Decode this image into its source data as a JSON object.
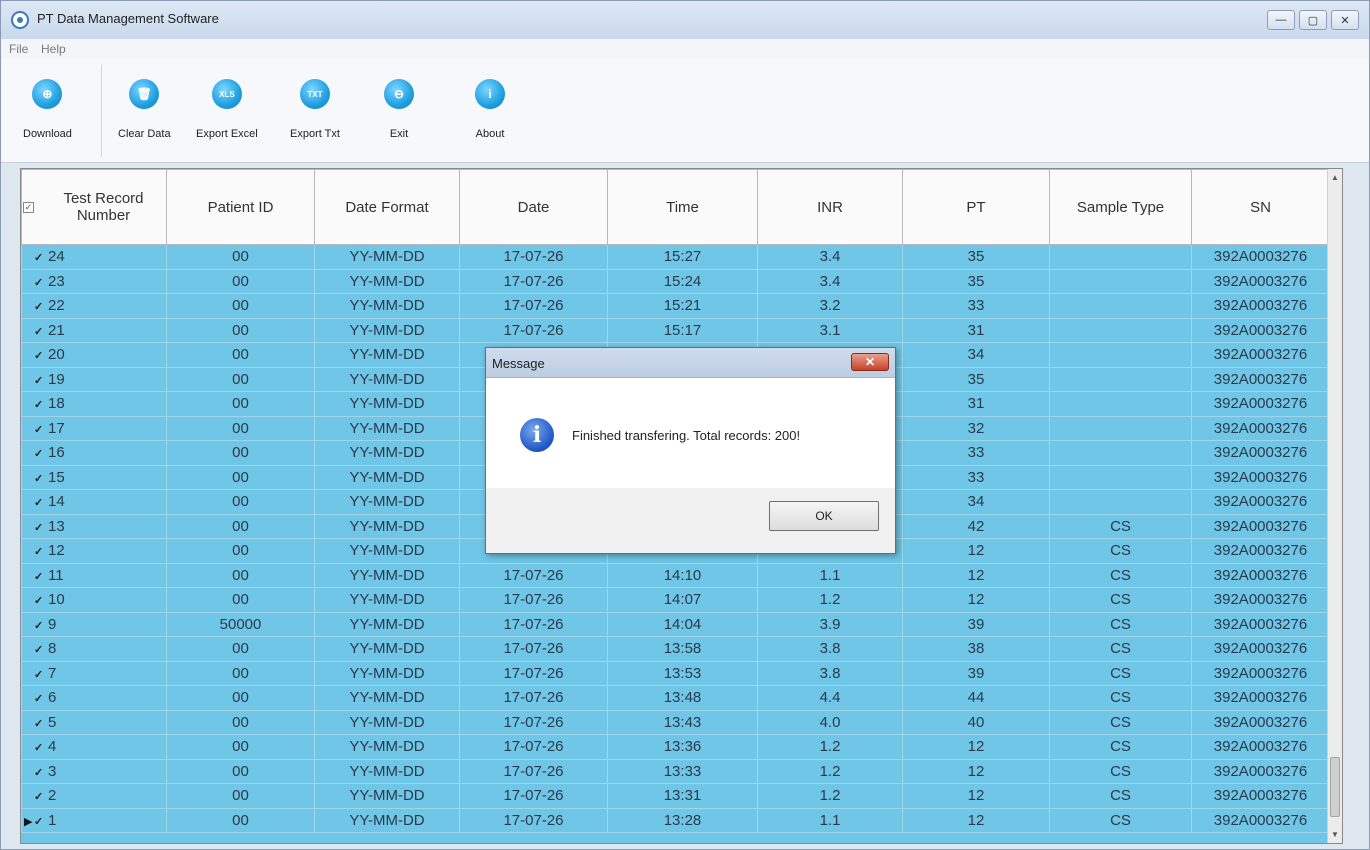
{
  "window": {
    "title": "PT Data Management Software",
    "controls": [
      "—",
      "▢",
      "✕"
    ]
  },
  "menu": {
    "file": "File",
    "help": "Help"
  },
  "toolbar": {
    "download": {
      "label": "Download",
      "glyph": "⊕"
    },
    "clear": {
      "label": "Clear Data",
      "glyph": "🗑"
    },
    "excel": {
      "label": "Export Excel",
      "glyph": "XLS"
    },
    "txt": {
      "label": "Export Txt",
      "glyph": "TXT"
    },
    "exit": {
      "label": "Exit",
      "glyph": "⊖"
    },
    "about": {
      "label": "About",
      "glyph": "i"
    }
  },
  "table": {
    "columns": [
      "Test Record Number",
      "Patient ID",
      "Date Format",
      "Date",
      "Time",
      "INR",
      "PT",
      "Sample Type",
      "SN"
    ],
    "rows": [
      {
        "num": "24",
        "pid": "00",
        "fmt": "YY-MM-DD",
        "date": "17-07-26",
        "time": "15:27",
        "inr": "3.4",
        "pt": "35",
        "sample": "",
        "sn": "392A0003276"
      },
      {
        "num": "23",
        "pid": "00",
        "fmt": "YY-MM-DD",
        "date": "17-07-26",
        "time": "15:24",
        "inr": "3.4",
        "pt": "35",
        "sample": "",
        "sn": "392A0003276"
      },
      {
        "num": "22",
        "pid": "00",
        "fmt": "YY-MM-DD",
        "date": "17-07-26",
        "time": "15:21",
        "inr": "3.2",
        "pt": "33",
        "sample": "",
        "sn": "392A0003276"
      },
      {
        "num": "21",
        "pid": "00",
        "fmt": "YY-MM-DD",
        "date": "17-07-26",
        "time": "15:17",
        "inr": "3.1",
        "pt": "31",
        "sample": "",
        "sn": "392A0003276"
      },
      {
        "num": "20",
        "pid": "00",
        "fmt": "YY-MM-DD",
        "date": "",
        "time": "",
        "inr": "",
        "pt": "34",
        "sample": "",
        "sn": "392A0003276"
      },
      {
        "num": "19",
        "pid": "00",
        "fmt": "YY-MM-DD",
        "date": "",
        "time": "",
        "inr": "",
        "pt": "35",
        "sample": "",
        "sn": "392A0003276"
      },
      {
        "num": "18",
        "pid": "00",
        "fmt": "YY-MM-DD",
        "date": "",
        "time": "",
        "inr": "",
        "pt": "31",
        "sample": "",
        "sn": "392A0003276"
      },
      {
        "num": "17",
        "pid": "00",
        "fmt": "YY-MM-DD",
        "date": "",
        "time": "",
        "inr": "",
        "pt": "32",
        "sample": "",
        "sn": "392A0003276"
      },
      {
        "num": "16",
        "pid": "00",
        "fmt": "YY-MM-DD",
        "date": "",
        "time": "",
        "inr": "",
        "pt": "33",
        "sample": "",
        "sn": "392A0003276"
      },
      {
        "num": "15",
        "pid": "00",
        "fmt": "YY-MM-DD",
        "date": "",
        "time": "",
        "inr": "",
        "pt": "33",
        "sample": "",
        "sn": "392A0003276"
      },
      {
        "num": "14",
        "pid": "00",
        "fmt": "YY-MM-DD",
        "date": "",
        "time": "",
        "inr": "",
        "pt": "34",
        "sample": "",
        "sn": "392A0003276"
      },
      {
        "num": "13",
        "pid": "00",
        "fmt": "YY-MM-DD",
        "date": "",
        "time": "",
        "inr": "",
        "pt": "42",
        "sample": "CS",
        "sn": "392A0003276"
      },
      {
        "num": "12",
        "pid": "00",
        "fmt": "YY-MM-DD",
        "date": "",
        "time": "",
        "inr": "",
        "pt": "12",
        "sample": "CS",
        "sn": "392A0003276"
      },
      {
        "num": "11",
        "pid": "00",
        "fmt": "YY-MM-DD",
        "date": "17-07-26",
        "time": "14:10",
        "inr": "1.1",
        "pt": "12",
        "sample": "CS",
        "sn": "392A0003276"
      },
      {
        "num": "10",
        "pid": "00",
        "fmt": "YY-MM-DD",
        "date": "17-07-26",
        "time": "14:07",
        "inr": "1.2",
        "pt": "12",
        "sample": "CS",
        "sn": "392A0003276"
      },
      {
        "num": "9",
        "pid": "50000",
        "fmt": "YY-MM-DD",
        "date": "17-07-26",
        "time": "14:04",
        "inr": "3.9",
        "pt": "39",
        "sample": "CS",
        "sn": "392A0003276"
      },
      {
        "num": "8",
        "pid": "00",
        "fmt": "YY-MM-DD",
        "date": "17-07-26",
        "time": "13:58",
        "inr": "3.8",
        "pt": "38",
        "sample": "CS",
        "sn": "392A0003276"
      },
      {
        "num": "7",
        "pid": "00",
        "fmt": "YY-MM-DD",
        "date": "17-07-26",
        "time": "13:53",
        "inr": "3.8",
        "pt": "39",
        "sample": "CS",
        "sn": "392A0003276"
      },
      {
        "num": "6",
        "pid": "00",
        "fmt": "YY-MM-DD",
        "date": "17-07-26",
        "time": "13:48",
        "inr": "4.4",
        "pt": "44",
        "sample": "CS",
        "sn": "392A0003276"
      },
      {
        "num": "5",
        "pid": "00",
        "fmt": "YY-MM-DD",
        "date": "17-07-26",
        "time": "13:43",
        "inr": "4.0",
        "pt": "40",
        "sample": "CS",
        "sn": "392A0003276"
      },
      {
        "num": "4",
        "pid": "00",
        "fmt": "YY-MM-DD",
        "date": "17-07-26",
        "time": "13:36",
        "inr": "1.2",
        "pt": "12",
        "sample": "CS",
        "sn": "392A0003276"
      },
      {
        "num": "3",
        "pid": "00",
        "fmt": "YY-MM-DD",
        "date": "17-07-26",
        "time": "13:33",
        "inr": "1.2",
        "pt": "12",
        "sample": "CS",
        "sn": "392A0003276"
      },
      {
        "num": "2",
        "pid": "00",
        "fmt": "YY-MM-DD",
        "date": "17-07-26",
        "time": "13:31",
        "inr": "1.2",
        "pt": "12",
        "sample": "CS",
        "sn": "392A0003276"
      },
      {
        "num": "1",
        "pid": "00",
        "fmt": "YY-MM-DD",
        "date": "17-07-26",
        "time": "13:28",
        "inr": "1.1",
        "pt": "12",
        "sample": "CS",
        "sn": "392A0003276",
        "current": true
      }
    ]
  },
  "dialog": {
    "title": "Message",
    "message": "Finished transfering. Total records: 200!",
    "ok_label": "OK",
    "close_glyph": "✕",
    "icon_glyph": "i"
  },
  "colors": {
    "grid_background": "#6fc6e6",
    "toolbar_icon": "#1f9fe0"
  }
}
